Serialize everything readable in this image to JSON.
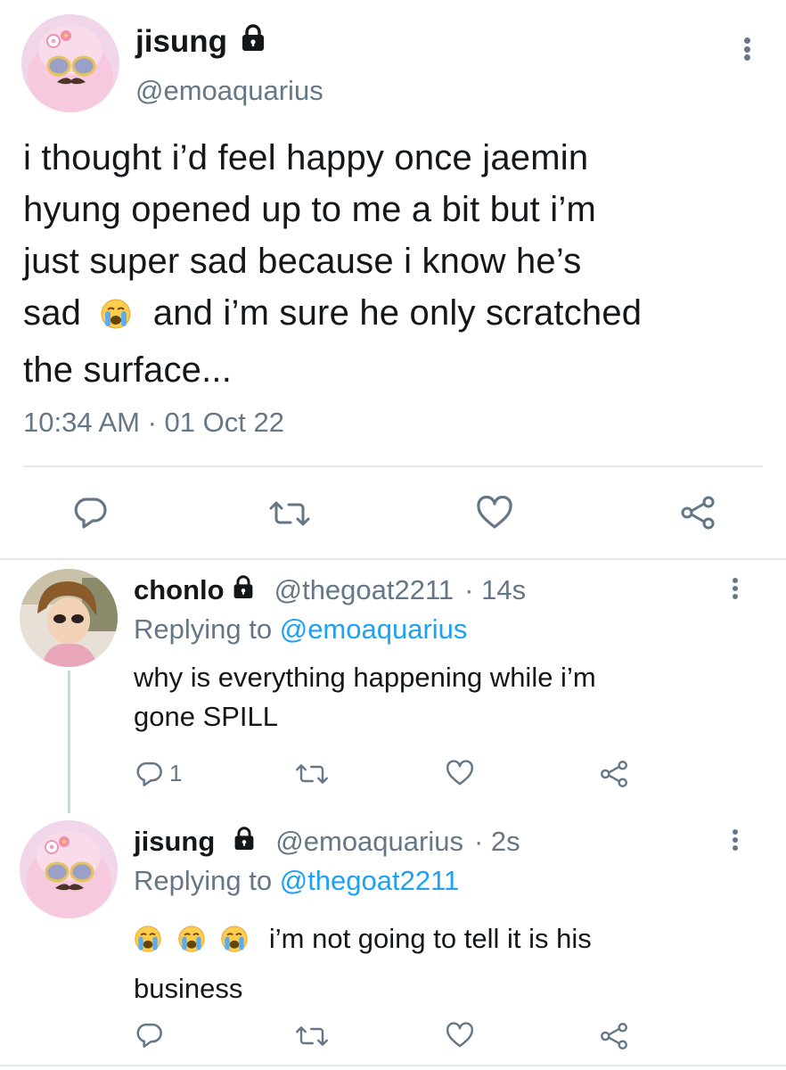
{
  "main_tweet": {
    "display_name": "jisung",
    "handle": "@emoaquarius",
    "text_line1": "i thought i’d feel happy once jaemin",
    "text_line2": "hyung opened up to me a bit but i’m",
    "text_line3": "just super sad because i know he’s",
    "text_line4a": "sad",
    "text_line4b": "and i’m sure he only scratched",
    "text_line5": "the surface...",
    "timestamp": "10:34 AM · 01 Oct 22",
    "locked": true
  },
  "replies": [
    {
      "display_name": "chonlo",
      "handle": "@thegoat2211",
      "time": "· 14s",
      "replying_prefix": "Replying to",
      "replying_to": "@emoaquarius",
      "text_line1": "why is everything happening while i’m",
      "text_line2": "gone SPILL",
      "reply_count": "1"
    },
    {
      "display_name": "jisung",
      "handle": "@emoaquarius",
      "time": "· 2s",
      "replying_prefix": "Replying to",
      "replying_to": "@thegoat2211",
      "text_line1": "i’m not going to tell it is his",
      "text_line2": "business",
      "reply_count": ""
    }
  ],
  "icons": [
    "reply-icon",
    "retweet-icon",
    "like-icon",
    "share-icon",
    "lock-icon",
    "more-icon",
    "crying-face-emoji"
  ],
  "colors": {
    "text": "#14171a",
    "secondary": "#657786",
    "link": "#1da1f2",
    "divider": "#e1e8ed"
  }
}
